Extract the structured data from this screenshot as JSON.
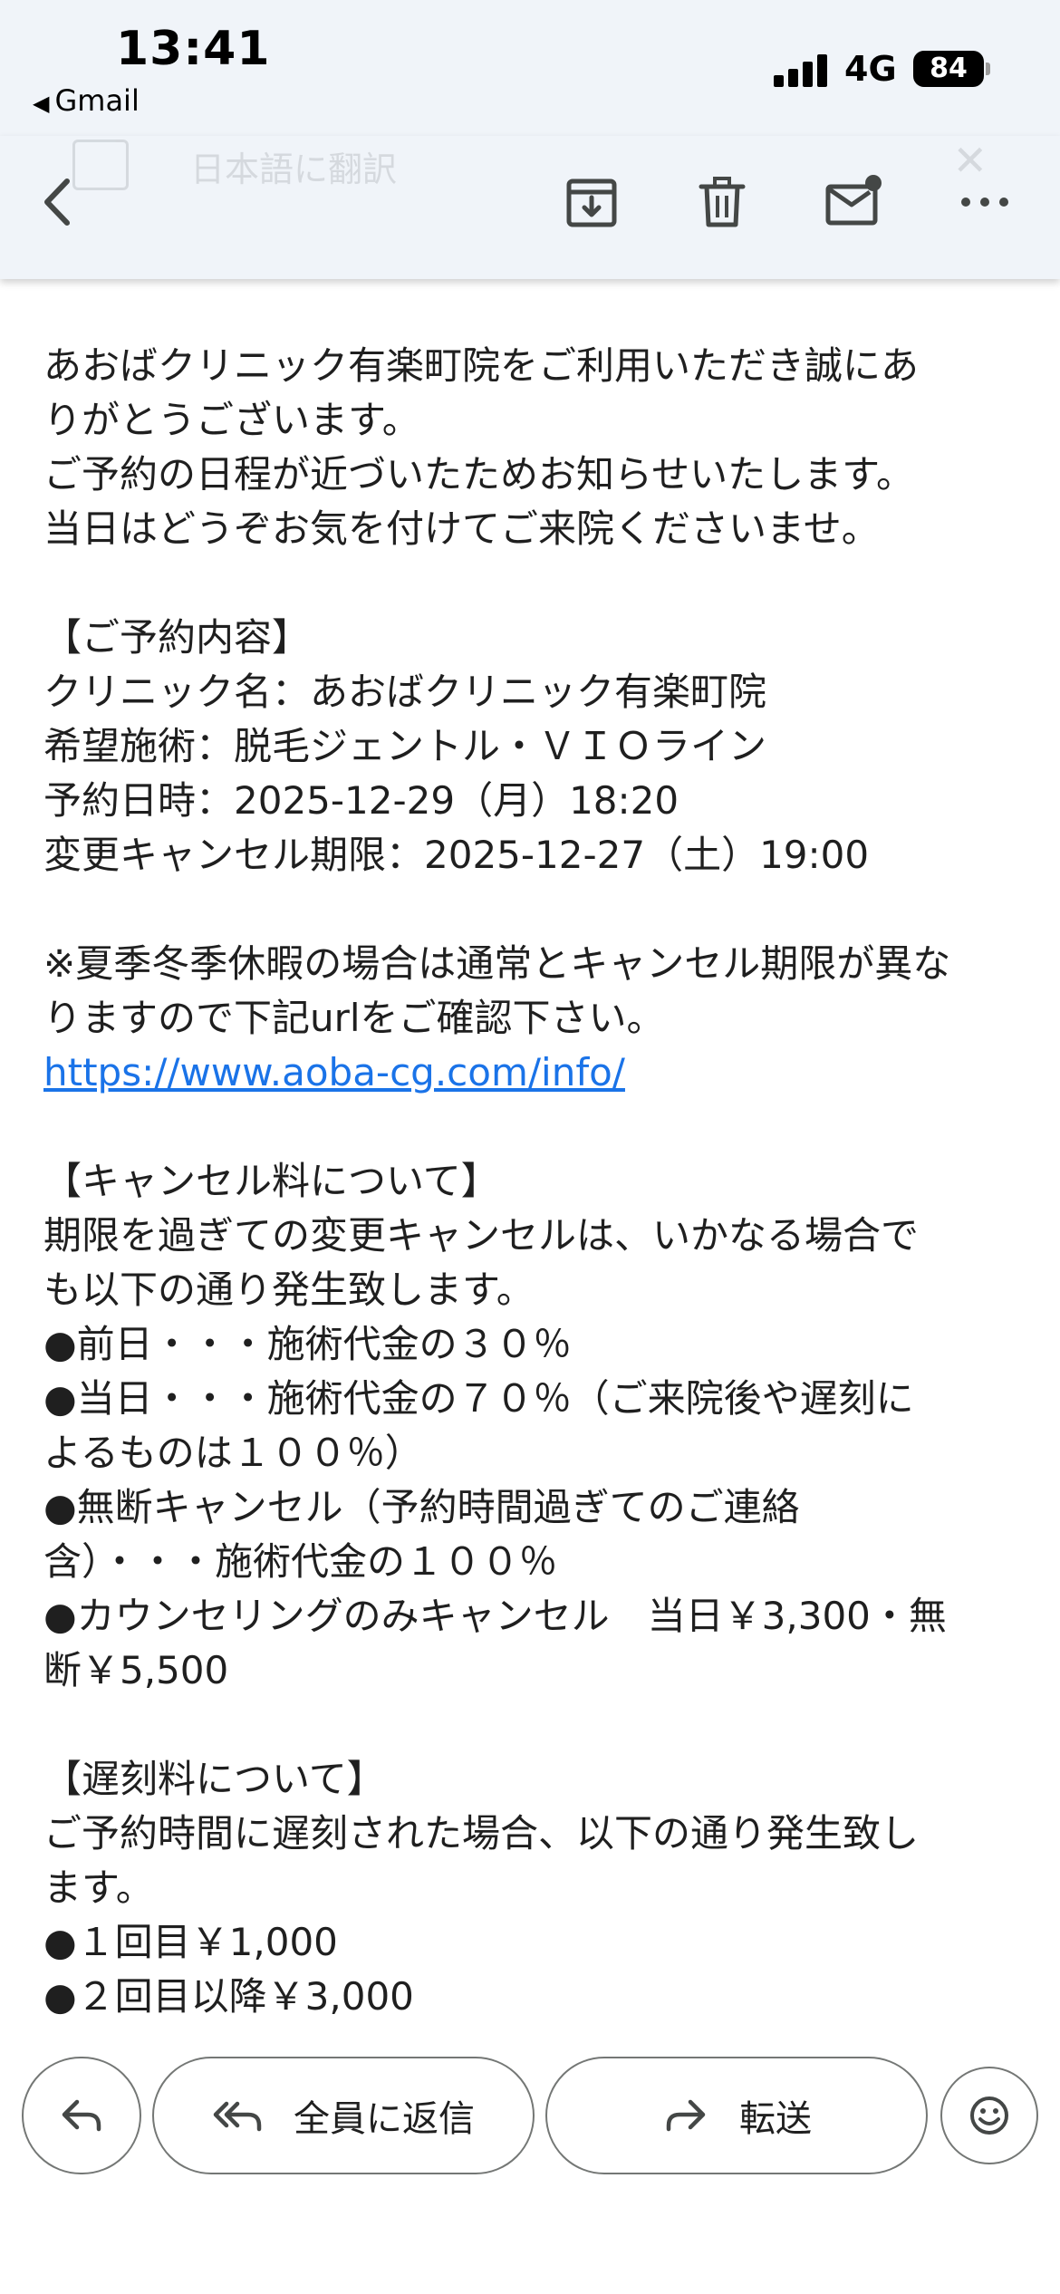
{
  "status": {
    "time": "13:41",
    "back_app": "Gmail",
    "network": "4G",
    "battery": "84"
  },
  "toolbar": {
    "translate_text": "日本語に翻訳"
  },
  "email": {
    "lines": [
      "あおばクリニック有楽町院をご利用いただき誠にあ",
      "りがとうございます。",
      "ご予約の日程が近づいたためお知らせいたします。",
      "当日はどうぞお気を付けてご来院くださいませ。",
      "",
      "【ご予約内容】",
      "クリニック名：あおばクリニック有楽町院",
      "希望施術：脱毛ジェントル・ＶＩＯライン",
      "予約日時：2025-12-29（月）18:20",
      "変更キャンセル期限：2025-12-27（土）19:00",
      "",
      "※夏季冬季休暇の場合は通常とキャンセル期限が異な",
      "りますので下記urlをご確認下さい。",
      "",
      "",
      "【キャンセル料について】",
      "期限を過ぎての変更キャンセルは、いかなる場合で",
      "も以下の通り発生致します。",
      "●前日・・・施術代金の３０％",
      "●当日・・・施術代金の７０％（ご来院後や遅刻に",
      "よるものは１００％）",
      "●無断キャンセル（予約時間過ぎてのご連絡",
      "含）・・・施術代金の１００％",
      "●カウンセリングのみキャンセル　当日￥3,300・無",
      "断￥5,500",
      "",
      "【遅刻料について】",
      "ご予約時間に遅刻された場合、以下の通り発生致し",
      "ます。",
      "●１回目￥1,000",
      "●２回目以降￥3,000"
    ],
    "link": "https://www.aoba-cg.com/info/"
  },
  "actions": {
    "reply_all": "全員に返信",
    "forward": "転送"
  },
  "colors": {
    "header_bg": "#f0f4f9",
    "link": "#1a73e8",
    "text": "#1f1f1f",
    "icon": "#444746"
  }
}
